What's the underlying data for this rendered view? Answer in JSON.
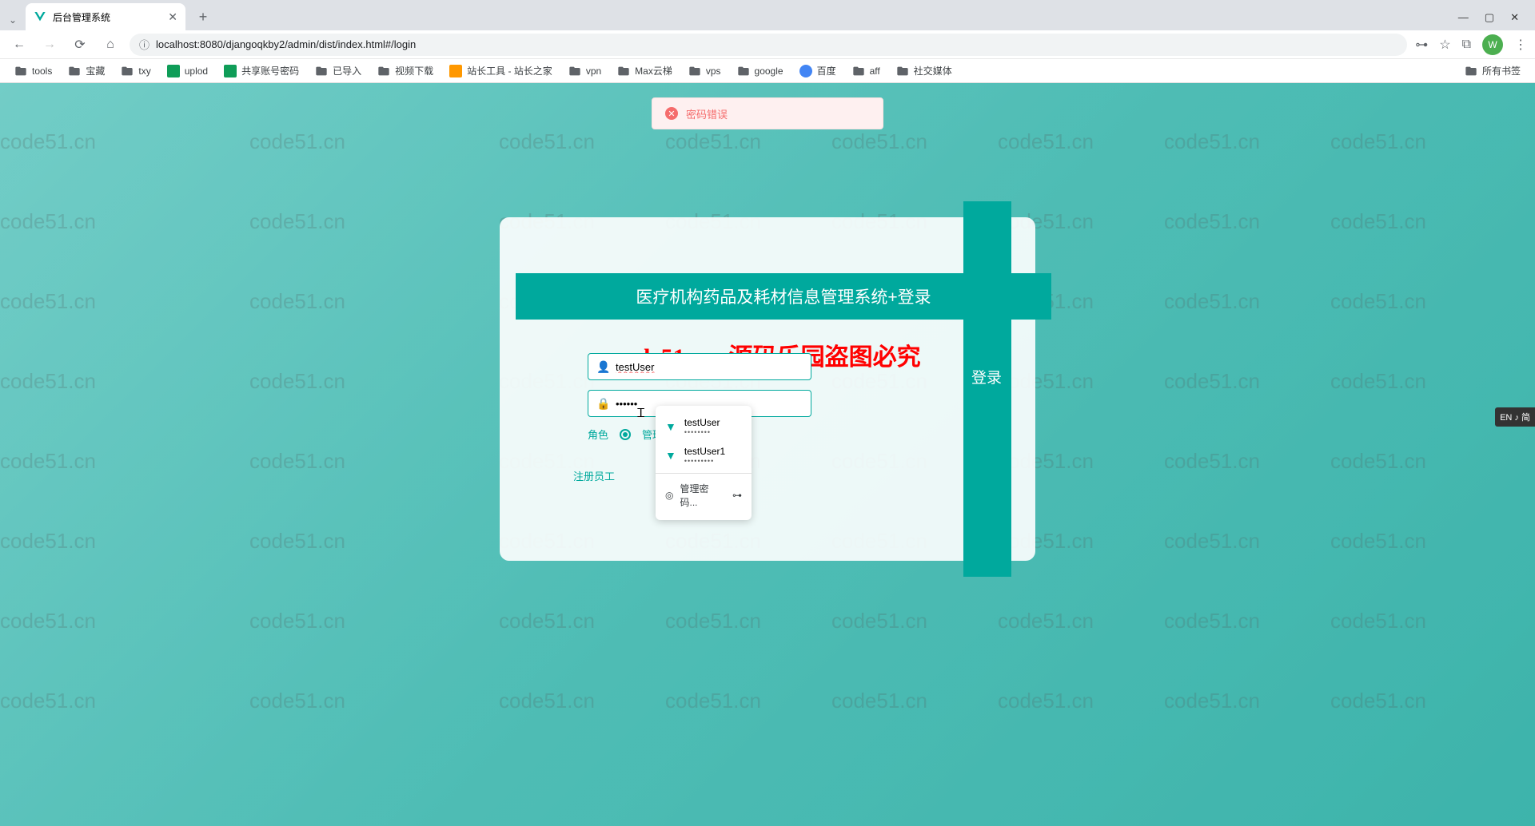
{
  "browser": {
    "tab_title": "后台管理系统",
    "url": "localhost:8080/djangoqkby2/admin/dist/index.html#/login",
    "avatar_letter": "W",
    "all_bookmarks": "所有书签"
  },
  "bookmarks": [
    {
      "label": "tools",
      "type": "folder"
    },
    {
      "label": "宝藏",
      "type": "folder"
    },
    {
      "label": "txy",
      "type": "folder"
    },
    {
      "label": "uplod",
      "type": "green"
    },
    {
      "label": "共享账号密码",
      "type": "green"
    },
    {
      "label": "已导入",
      "type": "folder"
    },
    {
      "label": "视频下载",
      "type": "folder"
    },
    {
      "label": "站长工具 - 站长之家",
      "type": "orange"
    },
    {
      "label": "vpn",
      "type": "folder"
    },
    {
      "label": "Max云梯",
      "type": "folder"
    },
    {
      "label": "vps",
      "type": "folder"
    },
    {
      "label": "google",
      "type": "folder"
    },
    {
      "label": "百度",
      "type": "blue"
    },
    {
      "label": "aff",
      "type": "folder"
    },
    {
      "label": "社交媒体",
      "type": "folder"
    }
  ],
  "error_message": "密码错误",
  "login": {
    "title": "医疗机构药品及耗材信息管理系统+登录",
    "username_value": "testUser",
    "password_value": "••••••",
    "role_label": "角色",
    "role_option": "管理",
    "login_button": "登录",
    "register_link": "注册员工"
  },
  "watermark_red": "code51. cn-源码乐园盗图必究",
  "watermark_text": "code51.cn",
  "password_suggestions": {
    "items": [
      {
        "user": "testUser",
        "dots": "••••••••"
      },
      {
        "user": "testUser1",
        "dots": "•••••••••"
      }
    ],
    "manage": "管理密码..."
  },
  "ime_label": "EN ♪ 简"
}
